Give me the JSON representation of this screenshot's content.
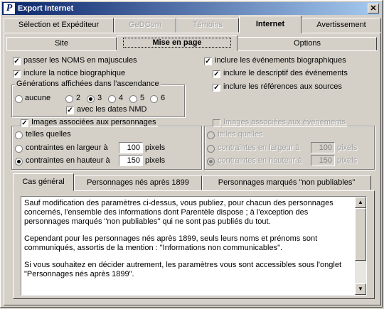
{
  "window": {
    "title": "Export Internet",
    "app_icon": "P",
    "close_glyph": "✕"
  },
  "tabs": [
    {
      "label": "Sélection et Expéditeur",
      "state": "normal"
    },
    {
      "label": "GeDCom",
      "state": "disabled"
    },
    {
      "label": "Témoins",
      "state": "disabled"
    },
    {
      "label": "Internet",
      "state": "active"
    },
    {
      "label": "Avertissement",
      "state": "normal"
    }
  ],
  "subtabs": [
    {
      "label": "Site",
      "state": "normal"
    },
    {
      "label": "Mise en page",
      "state": "active"
    },
    {
      "label": "Options",
      "state": "normal"
    }
  ],
  "left": {
    "upper_names": {
      "label": "passer les NOMS en majuscules",
      "checked": true
    },
    "bio_note": {
      "label": "inclure la notice biographique",
      "checked": true
    },
    "generations": {
      "title": "Générations affichées dans l'ascendance",
      "options": [
        "aucune",
        "2",
        "3",
        "4",
        "5",
        "6"
      ],
      "selected": "3",
      "nmd": {
        "label": "avec les dates NMD",
        "checked": true
      }
    },
    "images": {
      "title": "Images associées aux personnages",
      "checked": true,
      "opt_as_is": "telles quelles",
      "opt_width": "contraintes en largeur à",
      "opt_height": "contraintes en hauteur à",
      "selected": "height",
      "width_value": "100",
      "height_value": "150",
      "unit": "pixels"
    }
  },
  "right": {
    "bio_events": {
      "label": "inclure les événements biographiques",
      "checked": true
    },
    "event_desc": {
      "label": "inclure le descriptif des événements",
      "checked": true
    },
    "source_refs": {
      "label": "inclure les références aux sources",
      "checked": true
    },
    "images": {
      "title": "Images associées aux événements",
      "checked": false,
      "opt_as_is": "telles quelles",
      "opt_width": "contraintes en largeur à",
      "opt_height": "contraintes en hauteur à",
      "selected": "height",
      "width_value": "100",
      "height_value": "150",
      "unit": "pixels"
    }
  },
  "bottom_tabs": [
    {
      "label": "Cas général",
      "state": "active"
    },
    {
      "label": "Personnages nés après 1899",
      "state": "normal"
    },
    {
      "label": "Personnages marqués \"non publiables\"",
      "state": "normal"
    }
  ],
  "info_text": {
    "p1": "Sauf modification des paramètres ci-dessus, vous publiez, pour chacun des personnages concernés, l'ensemble des informations dont Parentèle dispose ; à l'exception des personnages  marqués \"non publiables\" qui ne sont pas publiés du tout.",
    "p2": "Cependant pour les personnages nés après 1899, seuls leurs noms et prénoms sont communiqués, assortis de la mention : \"Informations non communicables\".",
    "p3": "Si vous souhaitez en décider autrement, les paramètres vous sont accessibles sous l'onglet \"Personnages nés après 1899\"."
  },
  "scrollbar": {
    "up_glyph": "▲",
    "down_glyph": "▼"
  }
}
